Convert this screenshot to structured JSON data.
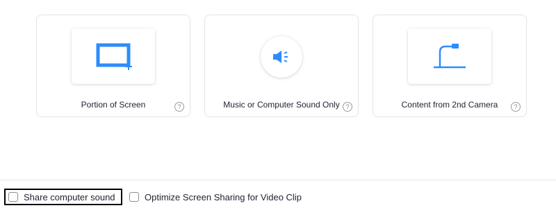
{
  "cards": [
    {
      "label": "Portion of Screen",
      "icon": "screen-portion-icon",
      "help": "?"
    },
    {
      "label": "Music or Computer Sound Only",
      "icon": "speaker-icon",
      "help": "?"
    },
    {
      "label": "Content from 2nd Camera",
      "icon": "document-camera-icon",
      "help": "?"
    }
  ],
  "options": {
    "share_sound": {
      "label": "Share computer sound",
      "checked": false
    },
    "optimize_video": {
      "label": "Optimize Screen Sharing for Video Clip",
      "checked": false
    }
  },
  "colors": {
    "accent": "#2D8CFF",
    "card_border": "#e3e3e3",
    "text": "#232333"
  }
}
